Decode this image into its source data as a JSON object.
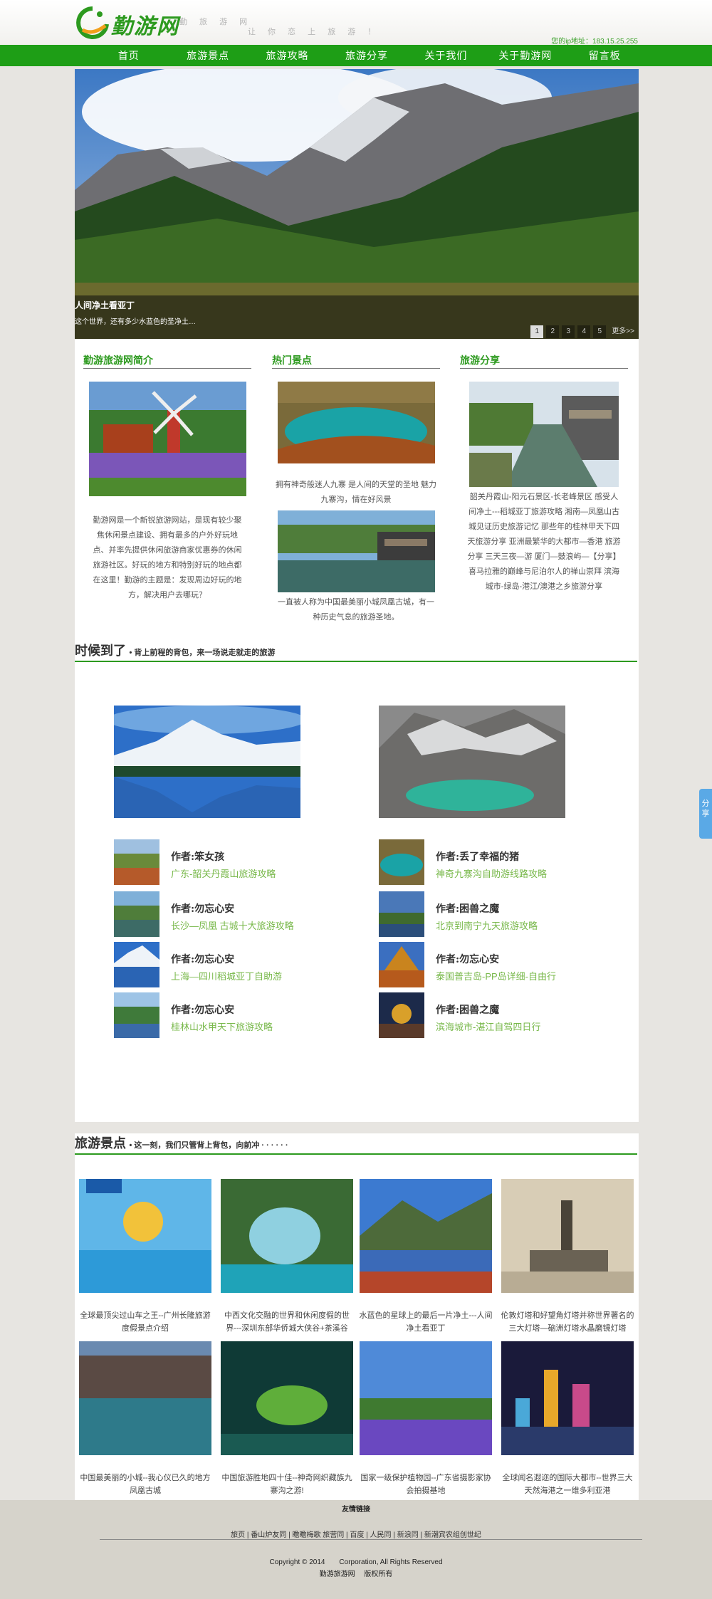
{
  "header": {
    "brand": "勤游网",
    "tagline1": "勤 旅 游 网",
    "tagline2": "让 你 恋 上 旅 游 ！",
    "ip_label": "您的ip地址：183.15.25.255"
  },
  "nav": {
    "items": [
      "首页",
      "旅游景点",
      "旅游攻略",
      "旅游分享",
      "关于我们",
      "关于勤游网",
      "留言板"
    ]
  },
  "banner": {
    "title": "人间净土看亚丁",
    "subtitle": "这个世界，还有多少水蓝色的圣净土…",
    "pages": [
      "1",
      "2",
      "3",
      "4",
      "5"
    ],
    "more": "更多>>"
  },
  "intro": {
    "heading": "勤游旅游网简介",
    "text": "勤游网是一个新锐旅游网站，是现有较少聚焦休闲景点建设、拥有最多的户外好玩地点、并率先提供休闲旅游商家优惠券的休闲旅游社区。好玩的地方和特别好玩的地点都在这里！勤游的主题是：发现周边好玩的地方，解决用户去哪玩？"
  },
  "hot": {
    "heading": "热门景点",
    "text1": "拥有神奇般迷人九寨 是人间的天堂的圣地 魅力九寨沟，情在好风景",
    "text2": "一直被人称为中国最美丽小城凤凰古城，有一种历史气息的旅游圣地。"
  },
  "share": {
    "heading": "旅游分享",
    "text": "韶关丹霞山-阳元石景区-长老峰景区 感受人间净土---稻城亚丁旅游攻略 湘南—凤凰山古城见证历史旅游记忆 那些年的桂林甲天下四　天旅游分享 亚洲最繁华的大都市—香港 旅游分享 三天三夜—游 厦门—鼓浪屿—【分享】喜马拉雅的巅峰与尼泊尔人的禅山崇拜 滨海城市-绿岛-港江/澳港之乡旅游分享"
  },
  "section1": {
    "title": "时候到了",
    "subtitle": "• 背上前程的背包，来一场说走就走的旅游"
  },
  "authors": [
    {
      "name": "作者:笨女孩",
      "link": "广东-韶关丹霞山旅游攻略"
    },
    {
      "name": "作者:勿忘心安",
      "link": "长沙—凤凰 古城十大旅游攻略"
    },
    {
      "name": "作者:勿忘心安",
      "link": "上海—四川稻城亚丁自助游"
    },
    {
      "name": "作者:勿忘心安",
      "link": "桂林山水甲天下旅游攻略"
    },
    {
      "name": "作者:丢了幸福的猪",
      "link": "神奇九寨沟自助游线路攻略"
    },
    {
      "name": "作者:困兽之魔",
      "link": "北京到南宁九天旅游攻略"
    },
    {
      "name": "作者:勿忘心安",
      "link": "泰国普吉岛-PP岛详细-自由行"
    },
    {
      "name": "作者:困兽之魔",
      "link": "滨海城市-湛江自驾四日行"
    }
  ],
  "section2": {
    "title": "旅游景点",
    "subtitle": "• 这一刻，我们只管背上背包，向前冲 · · · · · ·"
  },
  "spots": [
    {
      "caption": "全球最顶尖过山车之王--广州长隆旅游度假景点介绍"
    },
    {
      "caption": "中西文化交融的世界和休闲度假的世界---深圳东部华侨城大侠谷+茶溪谷"
    },
    {
      "caption": "水蓝色的星球上的最后一片净土---人间净土看亚丁"
    },
    {
      "caption": "伦敦灯塔和好望角灯塔并称世界著名的三大灯塔—硇洲灯塔水晶磨镜灯塔"
    },
    {
      "caption": "中国最美丽的小城--我心仪已久的地方凤凰古城"
    },
    {
      "caption": "中国旅游胜地四十佳--神奇网织藏族九寨沟之游!"
    },
    {
      "caption": "国家一级保护植物园--广东省摄影家协会拍摄基地"
    },
    {
      "caption": "全球闻名遐迩的国际大都市--世界三大天然海港之一维多利亚港"
    }
  ],
  "footer": {
    "links_title": "友情链接",
    "links": "旅页 | 番山炉友同 | 瞻瞻梅歌 旅营同 | 百度 | 人民同 | 新浪同 | 新潮宾农组创世纪",
    "copyright": "Copyright © 2014　　Corporation, All Rights Reserved",
    "owner": "勤游旅游网　 版权所有"
  },
  "share_tab": {
    "label": "分享"
  },
  "colors": {
    "brand_green": "#1e9e16",
    "link_green": "#78b84a",
    "share_blue": "#5aa9e6"
  }
}
